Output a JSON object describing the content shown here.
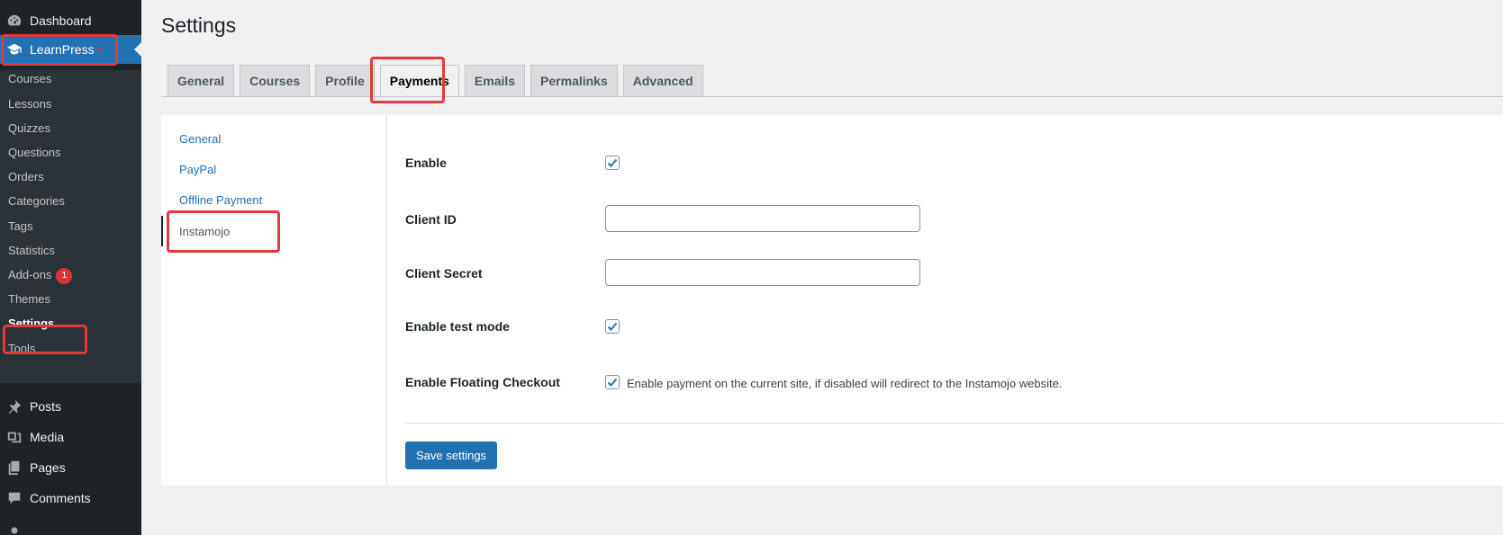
{
  "app": {
    "title": "Settings"
  },
  "sidebar": {
    "top_items": [
      {
        "label": "Dashboard",
        "icon": "dashboard-icon"
      },
      {
        "label": "LearnPress",
        "icon": "graduation-cap-icon"
      }
    ],
    "submenu": [
      {
        "label": "Courses"
      },
      {
        "label": "Lessons"
      },
      {
        "label": "Quizzes"
      },
      {
        "label": "Questions"
      },
      {
        "label": "Orders"
      },
      {
        "label": "Categories"
      },
      {
        "label": "Tags"
      },
      {
        "label": "Statistics"
      },
      {
        "label": "Add-ons",
        "badge": "1"
      },
      {
        "label": "Themes"
      },
      {
        "label": "Settings"
      },
      {
        "label": "Tools"
      }
    ],
    "bottom_items": [
      {
        "label": "Posts",
        "icon": "pushpin-icon"
      },
      {
        "label": "Media",
        "icon": "media-icon"
      },
      {
        "label": "Pages",
        "icon": "pages-icon"
      },
      {
        "label": "Comments",
        "icon": "comment-icon"
      }
    ]
  },
  "tabs": [
    {
      "label": "General"
    },
    {
      "label": "Courses"
    },
    {
      "label": "Profile"
    },
    {
      "label": "Payments"
    },
    {
      "label": "Emails"
    },
    {
      "label": "Permalinks"
    },
    {
      "label": "Advanced"
    }
  ],
  "subnav": [
    {
      "label": "General"
    },
    {
      "label": "PayPal"
    },
    {
      "label": "Offline Payment"
    },
    {
      "label": "Instamojo"
    }
  ],
  "form": {
    "enable": {
      "label": "Enable",
      "checked": true
    },
    "client_id": {
      "label": "Client ID",
      "value": ""
    },
    "client_secret": {
      "label": "Client Secret",
      "value": ""
    },
    "test_mode": {
      "label": "Enable test mode",
      "checked": true
    },
    "floating_checkout": {
      "label": "Enable Floating Checkout",
      "checked": true,
      "description": "Enable payment on the current site, if disabled will redirect to the Instamojo website."
    },
    "save_label": "Save settings"
  },
  "colors": {
    "accent": "#2271b1",
    "sidebar": "#1d2327",
    "highlight": "#e03a3e"
  }
}
